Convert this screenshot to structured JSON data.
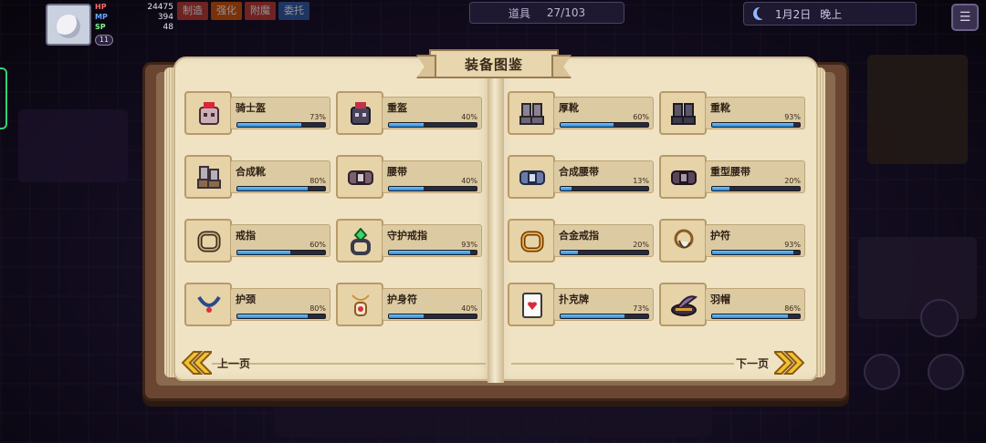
{
  "hud": {
    "hp_label": "HP",
    "hp_value": "24475",
    "mp_label": "MP",
    "mp_value": "394",
    "sp_label": "SP",
    "sp_value": "48",
    "level": "11",
    "tabs": [
      "制造",
      "强化",
      "附魔",
      "委托"
    ],
    "counter_label": "道具",
    "counter_value": "27/103",
    "date": "1月2日",
    "time_of_day": "晚上"
  },
  "book": {
    "title": "装备图鉴",
    "prev_label": "上一页",
    "next_label": "下一页",
    "accent_color": "#f2c230",
    "bar_color": "#3a9be6"
  },
  "items": [
    {
      "name": "骑士盔",
      "percent": "73%",
      "value": 73,
      "icon": "knight-helmet-icon"
    },
    {
      "name": "重盔",
      "percent": "40%",
      "value": 40,
      "icon": "heavy-helmet-icon"
    },
    {
      "name": "厚靴",
      "percent": "60%",
      "value": 60,
      "icon": "thick-boots-icon"
    },
    {
      "name": "重靴",
      "percent": "93%",
      "value": 93,
      "icon": "heavy-boots-icon"
    },
    {
      "name": "合成靴",
      "percent": "80%",
      "value": 80,
      "icon": "composite-boots-icon"
    },
    {
      "name": "腰带",
      "percent": "40%",
      "value": 40,
      "icon": "belt-icon"
    },
    {
      "name": "合成腰带",
      "percent": "13%",
      "value": 13,
      "icon": "composite-belt-icon"
    },
    {
      "name": "重型腰带",
      "percent": "20%",
      "value": 20,
      "icon": "heavy-belt-icon"
    },
    {
      "name": "戒指",
      "percent": "60%",
      "value": 60,
      "icon": "ring-icon"
    },
    {
      "name": "守护戒指",
      "percent": "93%",
      "value": 93,
      "icon": "guardian-ring-icon"
    },
    {
      "name": "合金戒指",
      "percent": "20%",
      "value": 20,
      "icon": "alloy-ring-icon"
    },
    {
      "name": "护符",
      "percent": "93%",
      "value": 93,
      "icon": "charm-icon"
    },
    {
      "name": "护颈",
      "percent": "80%",
      "value": 80,
      "icon": "neck-guard-icon"
    },
    {
      "name": "护身符",
      "percent": "40%",
      "value": 40,
      "icon": "amulet-icon"
    },
    {
      "name": "扑克牌",
      "percent": "73%",
      "value": 73,
      "icon": "poker-card-icon"
    },
    {
      "name": "羽帽",
      "percent": "86%",
      "value": 86,
      "icon": "feather-hat-icon"
    }
  ]
}
